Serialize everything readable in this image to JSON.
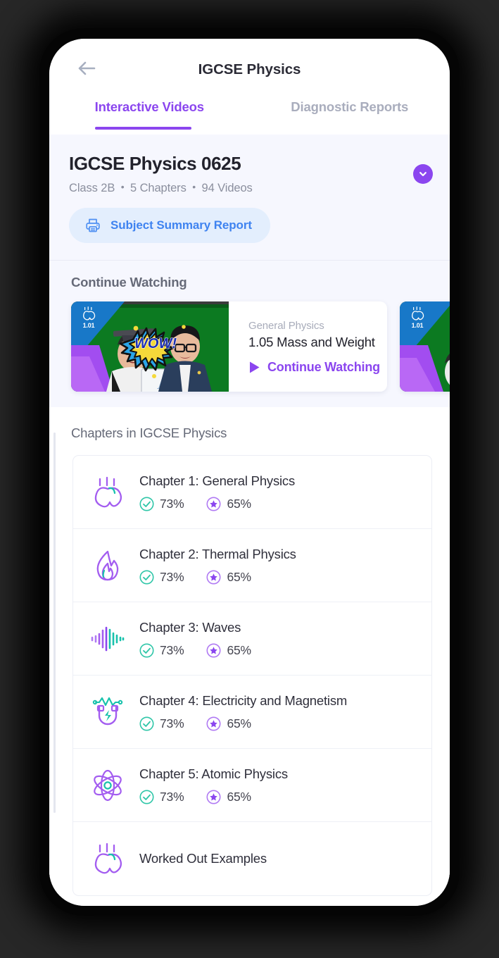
{
  "header": {
    "title": "IGCSE Physics",
    "back_icon": "arrow-left-icon"
  },
  "tabs": [
    {
      "label": "Interactive Videos",
      "active": true
    },
    {
      "label": "Diagnostic Reports",
      "active": false
    }
  ],
  "subject": {
    "title": "IGCSE Physics 0625",
    "class": "Class 2B",
    "chapters_count": "5 Chapters",
    "videos_count": "94 Videos",
    "separator": "•",
    "report_button": "Subject Summary Report",
    "report_icon": "printer-icon",
    "expand_icon": "chevron-down-icon"
  },
  "continue_watching": {
    "heading": "Continue Watching",
    "cards": [
      {
        "badge": "1.01",
        "subject": "General Physics",
        "title": "1.05 Mass and Weight",
        "action": "Continue Watching",
        "action_icon": "play-icon"
      },
      {
        "badge": "1.01",
        "subject": "",
        "title": "",
        "action": "",
        "action_icon": "play-icon"
      }
    ]
  },
  "chapters": {
    "heading": "Chapters in IGCSE Physics",
    "items": [
      {
        "name": "Chapter 1: General Physics",
        "icon": "apple-gravity-icon",
        "completion": "73%",
        "score": "65%"
      },
      {
        "name": "Chapter 2: Thermal Physics",
        "icon": "flame-icon",
        "completion": "73%",
        "score": "65%"
      },
      {
        "name": "Chapter 3: Waves",
        "icon": "waveform-icon",
        "completion": "73%",
        "score": "65%"
      },
      {
        "name": "Chapter 4: Electricity and Magnetism",
        "icon": "magnet-icon",
        "completion": "73%",
        "score": "65%"
      },
      {
        "name": "Chapter 5: Atomic Physics",
        "icon": "atom-icon",
        "completion": "73%",
        "score": "65%"
      },
      {
        "name": "Worked Out Examples",
        "icon": "apple-gravity-icon",
        "completion": "",
        "score": ""
      }
    ]
  },
  "colors": {
    "accent_purple": "#8b46ef",
    "link_blue": "#3f83f0",
    "teal": "#18c2ac",
    "green_check": "#2fc6a8",
    "text_dark": "#22222c",
    "text_muted": "#8b8f9e",
    "card_bg": "#f6f7fe"
  }
}
